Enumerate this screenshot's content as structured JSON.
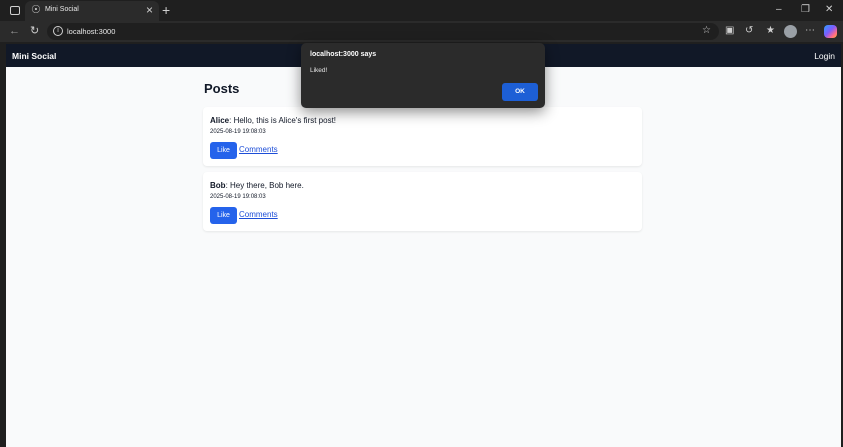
{
  "browser": {
    "tab_title": "Mini Social",
    "url": "localhost:3000"
  },
  "app": {
    "brand": "Mini Social",
    "login_label": "Login"
  },
  "main": {
    "heading": "Posts",
    "posts": [
      {
        "author": "Alice",
        "text": ": Hello, this is Alice's first post!",
        "timestamp": "2025-08-19 19:08:03",
        "like_label": "Like",
        "comments_label": "Comments"
      },
      {
        "author": "Bob",
        "text": ": Hey there, Bob here.",
        "timestamp": "2025-08-19 19:08:03",
        "like_label": "Like",
        "comments_label": "Comments"
      }
    ]
  },
  "alert": {
    "title": "localhost:3000 says",
    "message": "Liked!",
    "ok_label": "OK"
  },
  "colors": {
    "appbar_bg": "#111827",
    "primary_button": "#2563eb",
    "link": "#1d4ed8",
    "dialog_bg": "#2b2b2b"
  }
}
